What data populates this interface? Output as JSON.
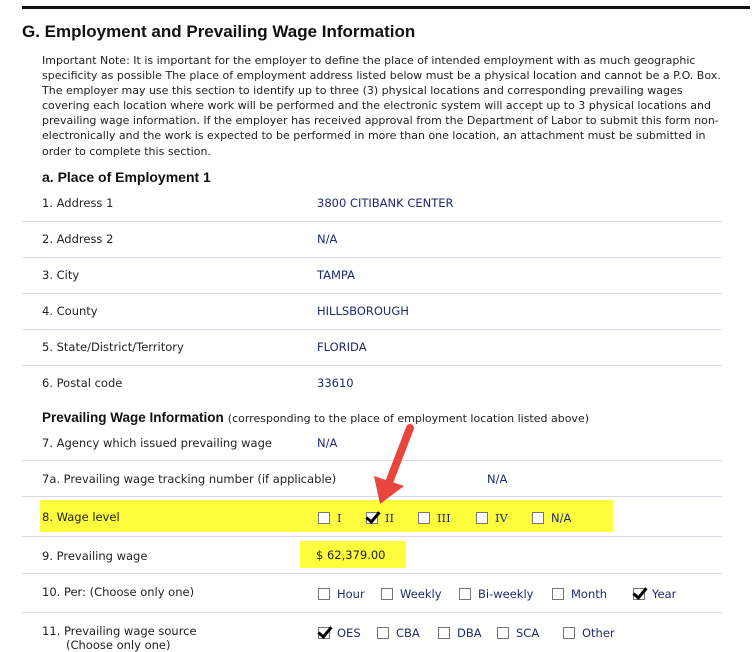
{
  "section": {
    "title": "G. Employment and Prevailing Wage Information",
    "note": "Important Note: It is important for the employer to define the place of intended employment with as much geographic specificity as possible The place of employment address listed below must be a physical location and cannot be a P.O. Box. The employer may use this section to identify up to three (3) physical locations and corresponding prevailing wages covering each location where work will be performed and the electronic system will accept up to 3 physical locations and prevailing wage information. If the employer has received approval from the Department of Labor to submit this form non-electronically and the work is expected to be performed in more than one location, an attachment must be submitted in order to complete this section."
  },
  "place": {
    "title": "a. Place of Employment 1",
    "rows": [
      {
        "label": "1. Address 1",
        "value": "3800 CITIBANK CENTER"
      },
      {
        "label": "2. Address 2",
        "value": "N/A"
      },
      {
        "label": "3. City",
        "value": "TAMPA"
      },
      {
        "label": "4. County",
        "value": "HILLSBOROUGH"
      },
      {
        "label": "5. State/District/Territory",
        "value": "FLORIDA"
      },
      {
        "label": "6. Postal code",
        "value": "33610"
      }
    ]
  },
  "wage": {
    "title": "Prevailing Wage Information",
    "subtitle": "(corresponding to the place of employment location listed above)",
    "agency_label": "7. Agency which issued prevailing wage",
    "agency_value": "N/A",
    "tracking_label": "7a. Prevailing wage tracking number (if applicable)",
    "tracking_value": "N/A",
    "level_label": "8. Wage level",
    "levels": [
      {
        "label": "I",
        "checked": false
      },
      {
        "label": "II",
        "checked": true
      },
      {
        "label": "III",
        "checked": false
      },
      {
        "label": "IV",
        "checked": false
      },
      {
        "label": "N/A",
        "checked": false
      }
    ],
    "wage_label": "9. Prevailing wage",
    "wage_value": "$ 62,379.00",
    "per_label": "10. Per: (Choose only one)",
    "per": [
      {
        "label": "Hour",
        "checked": false
      },
      {
        "label": "Weekly",
        "checked": false
      },
      {
        "label": "Bi-weekly",
        "checked": false
      },
      {
        "label": "Month",
        "checked": false
      },
      {
        "label": "Year",
        "checked": true
      }
    ],
    "source_label_1": "11. Prevailing wage source",
    "source_label_2": "(Choose only one)",
    "sources": [
      {
        "label": "OES",
        "checked": true
      },
      {
        "label": "CBA",
        "checked": false
      },
      {
        "label": "DBA",
        "checked": false
      },
      {
        "label": "SCA",
        "checked": false
      },
      {
        "label": "Other",
        "checked": false
      }
    ]
  },
  "colors": {
    "highlight": "#fdfd3e",
    "value_text": "#1f2a6e",
    "arrow": "#e8453c",
    "divider": "#d5dde8"
  }
}
